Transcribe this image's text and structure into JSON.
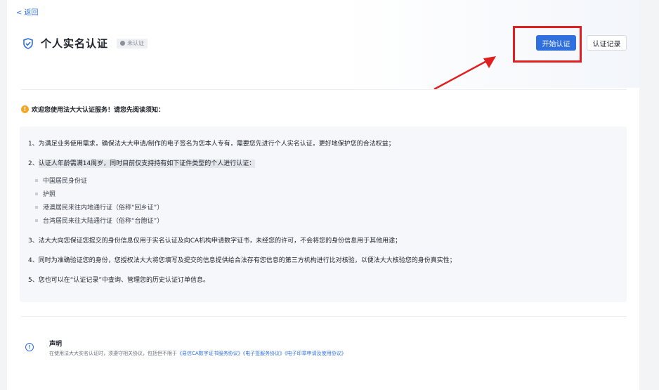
{
  "nav": {
    "back_label": "< 返回"
  },
  "header": {
    "title": "个人实名认证",
    "status_badge": "未认证",
    "start_button": "开始认证",
    "records_button": "认证记录"
  },
  "notice": {
    "icon_glyph": "!",
    "text": "欢迎您使用法大大认证服务！请您先阅读须知："
  },
  "terms": {
    "item1": "1、为满足业务使用需求，确保法大大申请/制作的电子签名为您本人专有，需要您先进行个人实名认证，更好地保护您的合法权益；",
    "item2_prefix": "2、",
    "item2": "认证人年龄需满14周岁，同时目前仅支持持有如下证件类型的个人进行认证：",
    "id_types": [
      "中国居民身份证",
      "护照",
      "港澳居民来往内地通行证（俗称“回乡证”）",
      "台湾居民来往大陆通行证（俗称“台胞证”）"
    ],
    "item3": "3、法大大向您保证您提交的身份信息仅用于实名认证及向CA机构申请数字证书，未经您的许可，不会将您的身份信息用于其他用途；",
    "item4": "4、同时为准确验证您的身份，您授权法大大将您填写及提交的信息提供给合法存有您信息的第三方机构进行比对核验，以便法大大核验您的身份真实性；",
    "item5": "5、您也可以在“认证记录”中查询、管理您的历史认证订单信息。"
  },
  "declaration": {
    "icon_glyph": "!",
    "title": "声明",
    "text": "在使用法大大实名认证时，须遵守相关协议，包括但不限于",
    "links": [
      "《易信CA数字证书服务协议》",
      "《电子签服务协议》",
      "《电子印章申请及使用协议》"
    ]
  },
  "colors": {
    "accent": "#2f6fde",
    "warning": "#f5a623",
    "highlight": "#e02020"
  }
}
